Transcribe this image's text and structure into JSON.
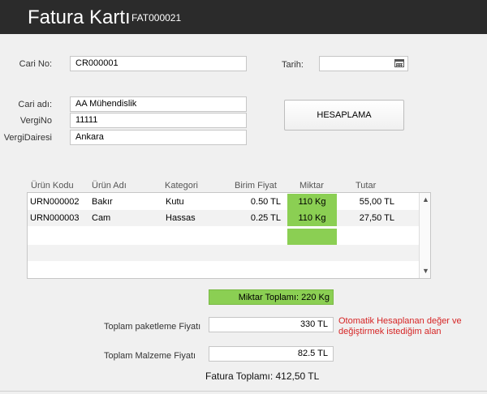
{
  "header": {
    "title": "Fatura Kartı",
    "code": "FAT000021"
  },
  "form": {
    "cari_no_label": "Cari No:",
    "cari_no_value": "CR000001",
    "tarih_label": "Tarih:",
    "tarih_value": "",
    "cari_adi_label": "Cari adı:",
    "cari_adi_value": "AA Mühendislik",
    "vergi_no_label": "VergiNo",
    "vergi_no_value": "11111",
    "vergi_dairesi_label": "VergiDairesi",
    "vergi_dairesi_value": "Ankara",
    "hesaplama_label": "HESAPLAMA"
  },
  "table": {
    "headers": [
      "Ürün Kodu",
      "Ürün Adı",
      "Kategori",
      "Birim Fiyat",
      "Miktar",
      "Tutar"
    ],
    "rows": [
      [
        "URN000002",
        "Bakır",
        "Kutu",
        "0.50 TL",
        "110 Kg",
        "55,00 TL"
      ],
      [
        "URN000003",
        "Cam",
        "Hassas",
        "0.25 TL",
        "110 Kg",
        "27,50 TL"
      ]
    ]
  },
  "totals": {
    "miktar_toplami": "Miktar Toplamı: 220 Kg",
    "paketleme_label": "Toplam paketleme Fiyatı",
    "paketleme_value": "330 TL",
    "malzeme_label": "Toplam Malzeme Fiyatı",
    "malzeme_value": "82.5 TL",
    "note_line1": "Otomatik Hesaplanan değer ve",
    "note_line2": "değiştirmek istediğim alan",
    "fatura_toplami": "Fatura Toplamı: 412,50 TL"
  },
  "colors": {
    "titlebar": "#2b2b2b",
    "accent_green": "#8bcf53",
    "note_red": "#d62525"
  },
  "icons": {
    "date_picker": "calendar-icon",
    "scroll_up": "chevron-up-icon",
    "scroll_down": "chevron-down-icon"
  }
}
